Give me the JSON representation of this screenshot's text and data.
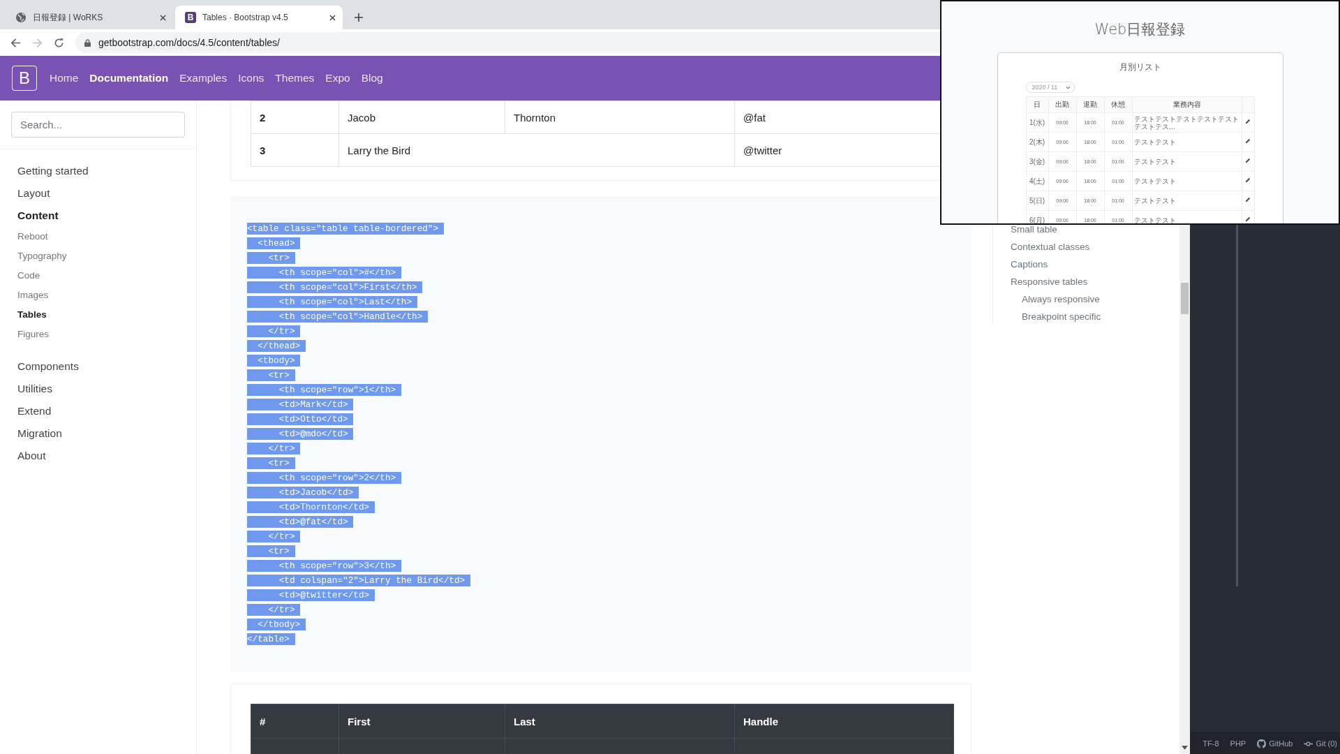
{
  "browser": {
    "tabs": [
      {
        "title": "日報登録 | WoRKS",
        "selected": false
      },
      {
        "title": "Tables · Bootstrap v4.5",
        "icon_text": "B",
        "selected": true
      }
    ],
    "forward_disabled": true,
    "url": "getbootstrap.com/docs/4.5/content/tables/"
  },
  "navbar": {
    "brand": "B",
    "links": [
      {
        "label": "Home",
        "selected": false
      },
      {
        "label": "Documentation",
        "selected": true
      },
      {
        "label": "Examples",
        "selected": false
      },
      {
        "label": "Icons",
        "selected": false
      },
      {
        "label": "Themes",
        "selected": false
      },
      {
        "label": "Expo",
        "selected": false
      },
      {
        "label": "Blog",
        "selected": false
      }
    ]
  },
  "sidebar": {
    "search": {
      "placeholder": "Search..."
    },
    "groups": [
      {
        "label": "Getting started",
        "selected": false
      },
      {
        "label": "Layout",
        "selected": false
      },
      {
        "label": "Content",
        "selected": true,
        "children": [
          {
            "label": "Reboot",
            "selected": false
          },
          {
            "label": "Typography",
            "selected": false
          },
          {
            "label": "Code",
            "selected": false
          },
          {
            "label": "Images",
            "selected": false
          },
          {
            "label": "Tables",
            "selected": true
          },
          {
            "label": "Figures",
            "selected": false
          }
        ]
      },
      {
        "label": "Components",
        "selected": false
      },
      {
        "label": "Utilities",
        "selected": false
      },
      {
        "label": "Extend",
        "selected": false
      },
      {
        "label": "Migration",
        "selected": false
      },
      {
        "label": "About",
        "selected": false
      }
    ]
  },
  "top_table": {
    "rows": [
      {
        "cells": [
          {
            "text": "2",
            "kind": "head"
          },
          {
            "text": "Jacob",
            "kind": "cell"
          },
          {
            "text": "Thornton",
            "kind": "cell"
          },
          {
            "text": "@fat",
            "kind": "cell"
          }
        ]
      },
      {
        "cells": [
          {
            "text": "3",
            "kind": "head"
          },
          {
            "text": "Larry the Bird",
            "kind": "cell",
            "colspan": 2
          },
          {
            "text": "@twitter",
            "kind": "cell"
          }
        ]
      }
    ]
  },
  "code": {
    "selected": true,
    "lines": [
      "<table class=\"table table-bordered\">",
      "  <thead>",
      "    <tr>",
      "      <th scope=\"col\">#</th>",
      "      <th scope=\"col\">First</th>",
      "      <th scope=\"col\">Last</th>",
      "      <th scope=\"col\">Handle</th>",
      "    </tr>",
      "  </thead>",
      "  <tbody>",
      "    <tr>",
      "      <th scope=\"row\">1</th>",
      "      <td>Mark</td>",
      "      <td>Otto</td>",
      "      <td>@mdo</td>",
      "    </tr>",
      "    <tr>",
      "      <th scope=\"row\">2</th>",
      "      <td>Jacob</td>",
      "      <td>Thornton</td>",
      "      <td>@fat</td>",
      "    </tr>",
      "    <tr>",
      "      <th scope=\"row\">3</th>",
      "      <td colspan=\"2\">Larry the Bird</td>",
      "      <td>@twitter</td>",
      "    </tr>",
      "  </tbody>",
      "</table>"
    ]
  },
  "dark_table": {
    "columns": [
      "#",
      "First",
      "Last",
      "Handle"
    ]
  },
  "toc": {
    "items": [
      {
        "label": "Small table"
      },
      {
        "label": "Contextual classes"
      },
      {
        "label": "Captions"
      },
      {
        "label": "Responsive tables",
        "children": [
          {
            "label": "Always responsive"
          },
          {
            "label": "Breakpoint specific"
          }
        ]
      }
    ]
  },
  "editor": {
    "status_bar": [
      {
        "label": "TF-8"
      },
      {
        "label": "PHP"
      },
      {
        "label": "GitHub"
      },
      {
        "label": "Git (0)"
      }
    ]
  },
  "overlay": {
    "title": "Web日報登録",
    "card_title": "月別リスト",
    "month": "2020 / 11",
    "columns": [
      "日",
      "出勤",
      "退勤",
      "休憩",
      "業務内容"
    ],
    "rows": [
      {
        "day": "1(水)",
        "start": "09:00",
        "end": "18:00",
        "rest": "01:00",
        "content": "テストテストテストテストテストテストテス…"
      },
      {
        "day": "2(木)",
        "start": "09:00",
        "end": "18:00",
        "rest": "01:00",
        "content": "テストテスト"
      },
      {
        "day": "3(金)",
        "start": "09:00",
        "end": "18:00",
        "rest": "01:00",
        "content": "テストテスト"
      },
      {
        "day": "4(土)",
        "start": "09:00",
        "end": "18:00",
        "rest": "01:00",
        "content": "テストテスト"
      },
      {
        "day": "5(日)",
        "start": "09:00",
        "end": "18:00",
        "rest": "01:00",
        "content": "テストテスト"
      },
      {
        "day": "6(月)",
        "start": "09:00",
        "end": "18:00",
        "rest": "01:00",
        "content": "テストテスト"
      }
    ]
  }
}
